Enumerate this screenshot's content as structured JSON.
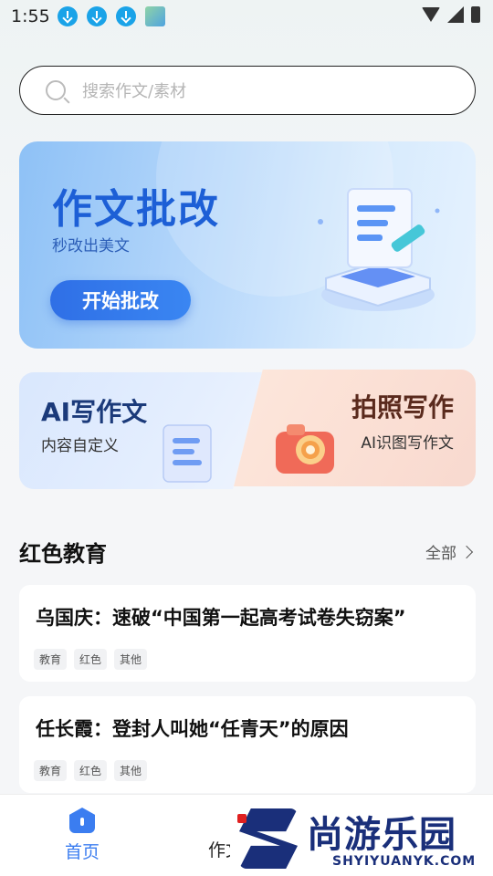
{
  "status_bar": {
    "time": "1:55",
    "notifications": [
      "download-icon",
      "download-icon",
      "download-icon",
      "app-icon"
    ],
    "right_icons": [
      "wifi-icon",
      "signal-icon",
      "battery-icon"
    ]
  },
  "search": {
    "placeholder": "搜索作文/素材"
  },
  "hero": {
    "title": "作文批改",
    "subtitle": "秒改出美文",
    "button_label": "开始批改"
  },
  "feature_cards": [
    {
      "title": "AI写作文",
      "subtitle": "内容自定义"
    },
    {
      "title": "拍照写作",
      "subtitle": "AI识图写作文"
    }
  ],
  "section": {
    "title": "红色教育",
    "more_label": "全部"
  },
  "articles": [
    {
      "title": "乌国庆：速破“中国第一起高考试卷失窃案”",
      "tags": [
        "教育",
        "红色",
        "其他"
      ]
    },
    {
      "title": "任长霞：登封人叫她“任青天”的原因",
      "tags": [
        "教育",
        "红色",
        "其他"
      ]
    }
  ],
  "bottom_nav": {
    "home_label": "首页",
    "essay_label": "作文"
  },
  "watermark": {
    "text": "尚游乐园",
    "url": "SHYIYUANYK.COM"
  },
  "colors": {
    "accent": "#3b7df0",
    "hero_title": "#1d5fd6",
    "watermark": "#1a2f7a"
  }
}
